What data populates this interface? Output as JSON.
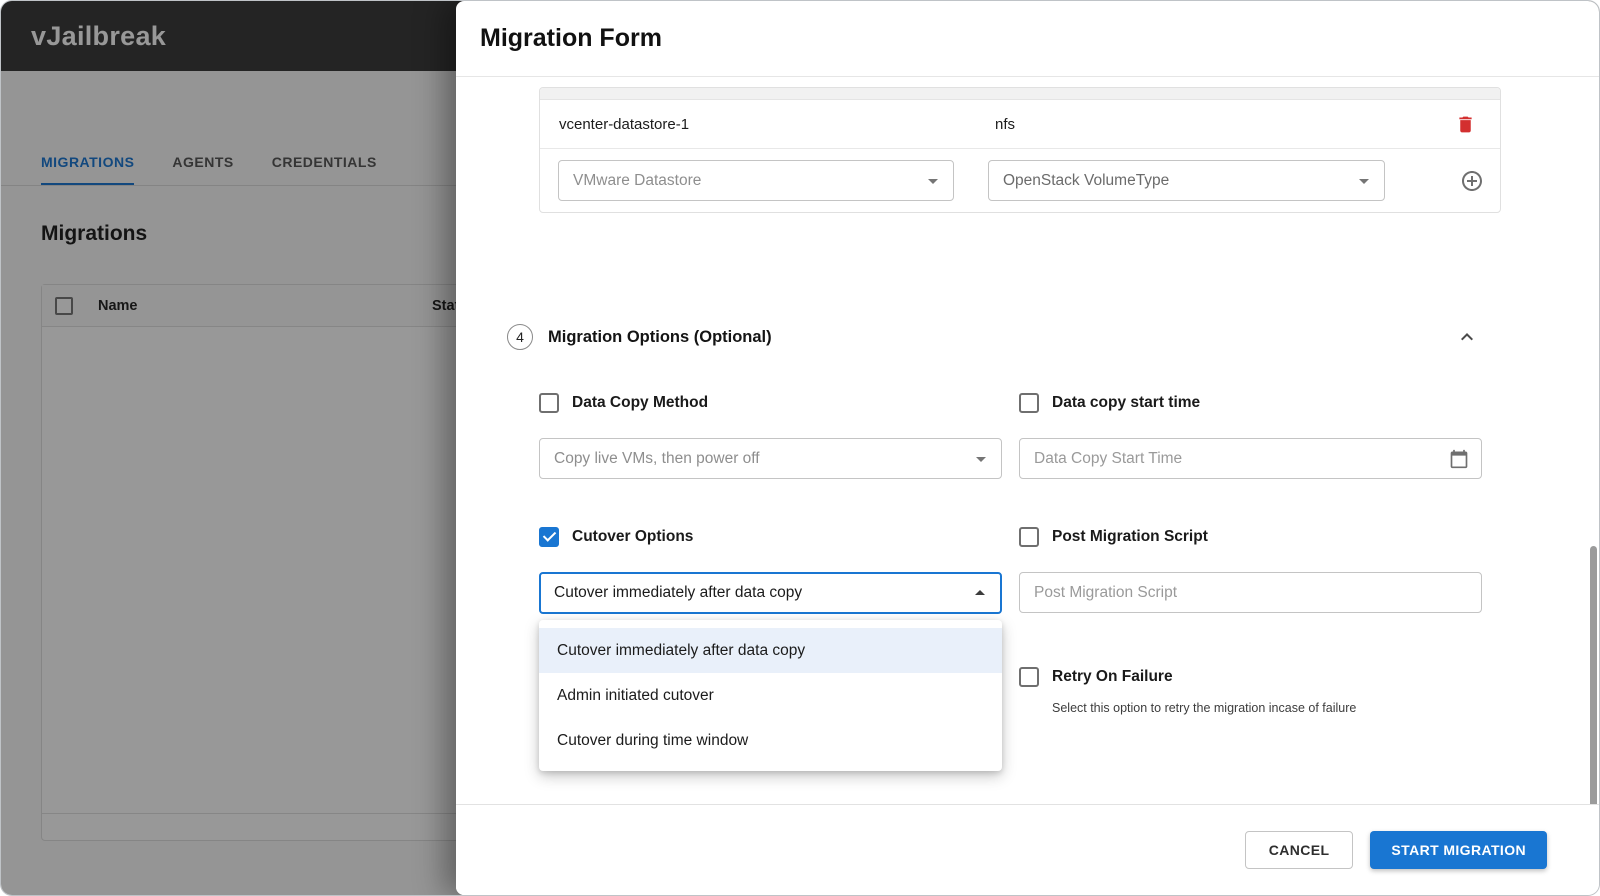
{
  "app": {
    "brand": "vJailbreak",
    "tabs": [
      {
        "label": "MIGRATIONS",
        "active": true
      },
      {
        "label": "AGENTS",
        "active": false
      },
      {
        "label": "CREDENTIALS",
        "active": false
      }
    ],
    "page_title": "Migrations",
    "table": {
      "name_col": "Name",
      "status_col": "Status"
    }
  },
  "drawer": {
    "title": "Migration Form",
    "datastore_block": {
      "row": {
        "source": "vcenter-datastore-1",
        "target": "nfs"
      },
      "vmware_select_placeholder": "VMware Datastore",
      "openstack_select_placeholder": "OpenStack VolumeType"
    },
    "options_section": {
      "step": "4",
      "title": "Migration Options (Optional)"
    },
    "fields": {
      "data_copy_method": {
        "label": "Data Copy Method",
        "checked": false,
        "value": "Copy live VMs, then power off"
      },
      "data_copy_start_time": {
        "label": "Data copy start time",
        "checked": false,
        "placeholder": "Data Copy Start Time"
      },
      "cutover_options": {
        "label": "Cutover Options",
        "checked": true,
        "value": "Cutover immediately after data copy",
        "menu": [
          {
            "label": "Cutover immediately after data copy",
            "selected": true
          },
          {
            "label": "Admin initiated cutover",
            "selected": false
          },
          {
            "label": "Cutover during time window",
            "selected": false
          }
        ]
      },
      "post_migration_script": {
        "label": "Post Migration Script",
        "checked": false,
        "placeholder": "Post Migration Script"
      },
      "retry_on_failure": {
        "label": "Retry On Failure",
        "checked": false,
        "helper_text": "Select this option to retry the migration incase of failure"
      }
    },
    "footer": {
      "cancel_label": "CANCEL",
      "submit_label": "START MIGRATION"
    }
  },
  "colors": {
    "accent": "#1976d2",
    "danger_red": "#d32f2f",
    "selected_option_bg": "#e9f0fa"
  }
}
